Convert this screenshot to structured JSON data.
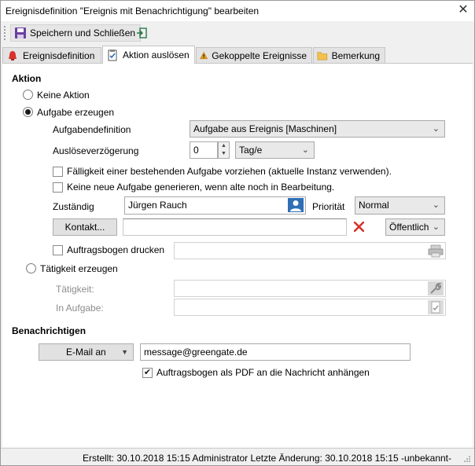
{
  "window": {
    "title": "Ereignisdefinition \"Ereignis mit Benachrichtigung\" bearbeiten",
    "close_glyph": "✕"
  },
  "toolbar": {
    "save_close_label": "Speichern und Schließen"
  },
  "tabs": [
    {
      "label": "Ereignisdefinition",
      "icon": "alarm-icon",
      "active": false
    },
    {
      "label": "Aktion auslösen",
      "icon": "clipboard-check-icon",
      "active": true
    },
    {
      "label": "Gekoppelte Ereignisse",
      "icon": "warning-icon",
      "active": false
    },
    {
      "label": "Bemerkung",
      "icon": "folder-icon",
      "active": false
    }
  ],
  "aktion": {
    "heading": "Aktion",
    "radio_keine": "Keine Aktion",
    "radio_aufgabe": "Aufgabe erzeugen",
    "aufgabendefinition_label": "Aufgabendefinition",
    "aufgabendefinition_value": "Aufgabe aus Ereignis [Maschinen]",
    "ausloeseverzoegerung_label": "Auslöseverzögerung",
    "ausloeseverzoegerung_value": "0",
    "einheit_value": "Tag/e",
    "check_faelligkeit": "Fälligkeit einer bestehenden Aufgabe vorziehen (aktuelle Instanz verwenden).",
    "check_keine_neue": "Keine neue Aufgabe generieren, wenn alte noch in Bearbeitung.",
    "zustaendig_label": "Zuständig",
    "zustaendig_value": "Jürgen Rauch",
    "prioritaet_label": "Priorität",
    "prioritaet_value": "Normal",
    "kontakt_button": "Kontakt...",
    "kontakt_value": "",
    "sichtbarkeit_value": "Öffentlich",
    "check_auftragsbogen": "Auftragsbogen drucken",
    "radio_taetigkeit": "Tätigkeit erzeugen",
    "taetigkeit_label": "Tätigkeit:",
    "in_aufgabe_label": "In Aufgabe:"
  },
  "benachrichtigen": {
    "heading": "Benachrichtigen",
    "email_button": "E-Mail an",
    "email_value": "message@greengate.de",
    "check_pdf": "Auftragsbogen als PDF an die Nachricht anhängen"
  },
  "status": {
    "text": "Erstellt: 30.10.2018 15:15 Administrator  Letzte Änderung: 30.10.2018 15:15 -unbekannt-"
  },
  "colors": {
    "accent_blue": "#2e6fb6",
    "delete_red": "#d9312b",
    "panel_bg": "#ffffff",
    "window_bg": "#f0f0f0"
  }
}
